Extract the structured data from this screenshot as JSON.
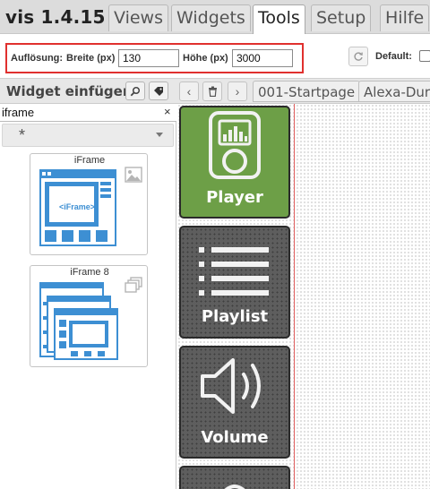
{
  "app": {
    "title": "vis 1.4.15"
  },
  "menu": {
    "tabs": [
      "Views",
      "Widgets",
      "Tools",
      "Setup",
      "Hilfe"
    ],
    "active": "Tools"
  },
  "toolbar": {
    "resolution_label": "Auflösung:",
    "width_label": "Breite (px)",
    "width_value": "130",
    "height_label": "Höhe (px)",
    "height_value": "3000",
    "default_label": "Default:",
    "highlight_color": "#e0302e"
  },
  "widget_panel": {
    "title": "Widget einfügen",
    "search_value": "iframe",
    "clear_symbol": "×",
    "filter_value": "*",
    "widgets": [
      {
        "label": "iFrame",
        "preview_text": "<iFrame>"
      },
      {
        "label": "iFrame 8"
      }
    ]
  },
  "views_bar": {
    "tabs": [
      "001-Startpage",
      "Alexa-Dur"
    ]
  },
  "canvas": {
    "tiles": [
      {
        "label": "Player",
        "icon": "player-device-icon",
        "color": "#6d9f47"
      },
      {
        "label": "Playlist",
        "icon": "playlist-icon",
        "color": "#5e5e5e"
      },
      {
        "label": "Volume",
        "icon": "speaker-volume-icon",
        "color": "#5e5e5e"
      }
    ]
  },
  "colors": {
    "icon_blue": "#3d8fd3",
    "accent_green": "#6d9f47"
  }
}
